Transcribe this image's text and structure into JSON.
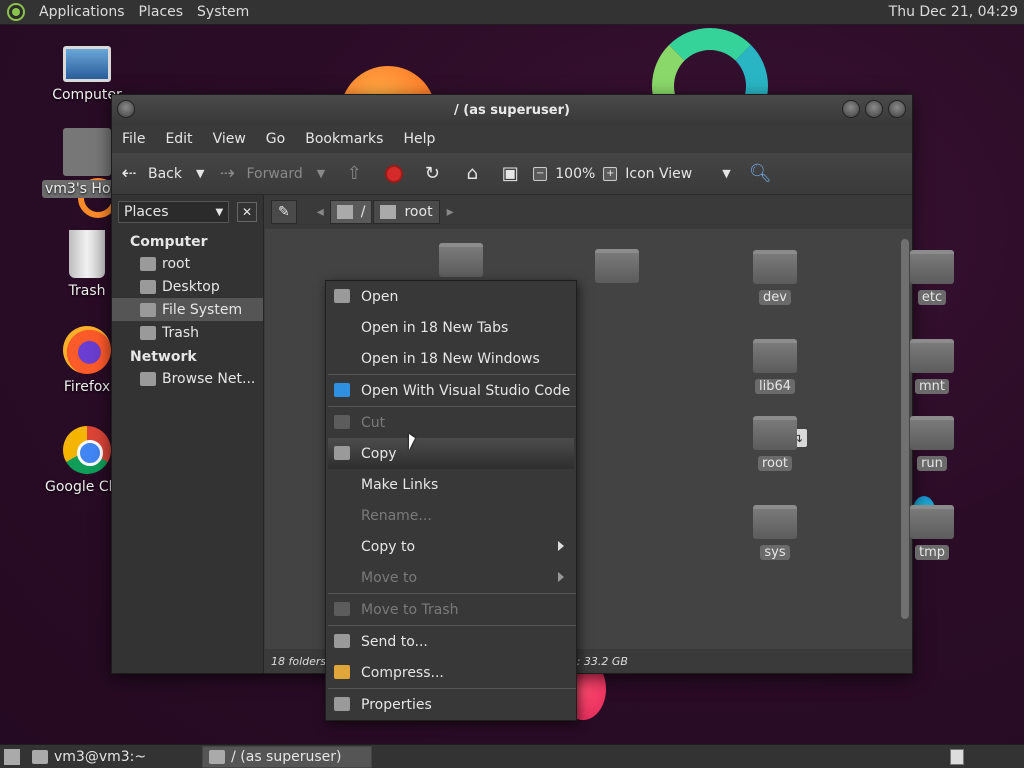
{
  "top_panel": {
    "menus": [
      "Applications",
      "Places",
      "System"
    ],
    "clock": "Thu Dec 21, 04:29"
  },
  "desktop": {
    "icons": [
      {
        "label": "Computer",
        "icon": "computer-icon"
      },
      {
        "label": "vm3's Home",
        "icon": "home-folder-icon"
      },
      {
        "label": "Trash",
        "icon": "trash-icon"
      },
      {
        "label": "Firefox",
        "icon": "firefox-icon"
      },
      {
        "label": "Google Chrome",
        "icon": "chrome-icon"
      }
    ]
  },
  "window": {
    "title": "/ (as superuser)",
    "menubar": [
      "File",
      "Edit",
      "View",
      "Go",
      "Bookmarks",
      "Help"
    ],
    "toolbar": {
      "back": "Back",
      "forward": "Forward",
      "zoom": "100%",
      "view_mode": "Icon View"
    },
    "sidebar": {
      "title": "Places",
      "groups": [
        {
          "name": "Computer",
          "items": [
            "root",
            "Desktop",
            "File System",
            "Trash"
          ]
        },
        {
          "name": "Network",
          "items": [
            "Browse Net..."
          ]
        }
      ],
      "active_item": "File System"
    },
    "pathbar": {
      "crumbs": [
        "/",
        "root"
      ]
    },
    "folders": [
      "dev",
      "etc",
      "lib64",
      "mnt",
      "root",
      "run",
      "sys",
      "tmp"
    ],
    "status_left": "18 folders",
    "status_right": "pace: 33.2 GB"
  },
  "context_menu": {
    "items": [
      {
        "label": "Open",
        "icon": "open-icon",
        "disabled": false
      },
      {
        "label": "Open in 18 New Tabs",
        "icon": "",
        "disabled": false
      },
      {
        "label": "Open in 18 New Windows",
        "icon": "",
        "disabled": false
      },
      {
        "label": "Open With Visual Studio Code",
        "icon": "vscode-icon",
        "disabled": false
      },
      {
        "label": "Cut",
        "icon": "scissors-icon",
        "disabled": true
      },
      {
        "label": "Copy",
        "icon": "copy-icon",
        "disabled": false,
        "highlighted": true
      },
      {
        "label": "Make Links",
        "icon": "",
        "disabled": false
      },
      {
        "label": "Rename...",
        "icon": "",
        "disabled": true
      },
      {
        "label": "Copy to",
        "icon": "",
        "disabled": false,
        "submenu": true
      },
      {
        "label": "Move to",
        "icon": "",
        "disabled": true,
        "submenu": true
      },
      {
        "label": "Move to Trash",
        "icon": "trash-icon",
        "disabled": true
      },
      {
        "label": "Send to...",
        "icon": "send-icon",
        "disabled": false
      },
      {
        "label": "Compress...",
        "icon": "archive-icon",
        "disabled": false
      },
      {
        "label": "Properties",
        "icon": "properties-icon",
        "disabled": false
      }
    ]
  },
  "bottom_panel": {
    "tasks": [
      {
        "label": "vm3@vm3:~",
        "active": false
      },
      {
        "label": "/ (as superuser)",
        "active": true
      }
    ]
  }
}
